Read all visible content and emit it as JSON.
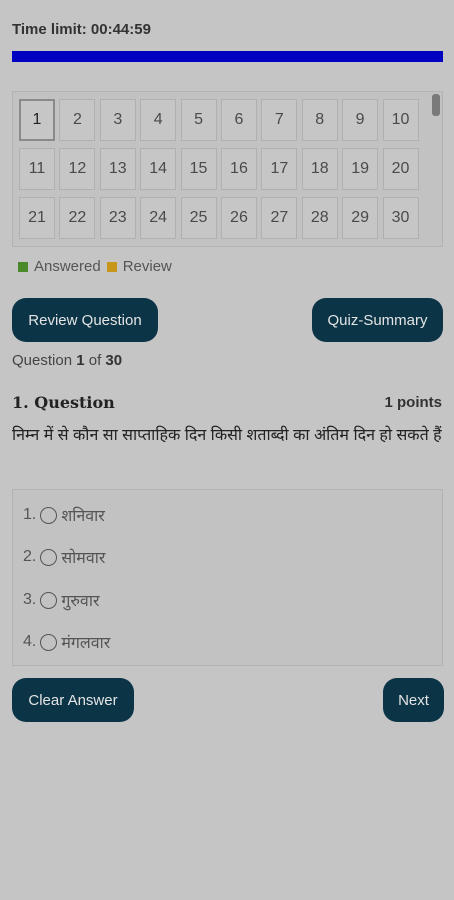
{
  "timer": {
    "label": "Time limit: 00:44:59"
  },
  "progress": {
    "fraction": 1.0,
    "color": "#0000c0"
  },
  "question_grid": {
    "numbers": [
      "1",
      "2",
      "3",
      "4",
      "5",
      "6",
      "7",
      "8",
      "9",
      "10",
      "11",
      "12",
      "13",
      "14",
      "15",
      "16",
      "17",
      "18",
      "19",
      "20",
      "21",
      "22",
      "23",
      "24",
      "25",
      "26",
      "27",
      "28",
      "29",
      "30"
    ],
    "current": 1
  },
  "legend": {
    "answered": "Answered",
    "review": "Review",
    "answered_color": "#4a8a2a",
    "review_color": "#c8961a"
  },
  "buttons": {
    "review_question": "Review Question",
    "quiz_summary": "Quiz-Summary",
    "clear_answer": "Clear Answer",
    "next": "Next"
  },
  "counter": {
    "prefix": "Question ",
    "current": "1",
    "mid": " of ",
    "total": "30"
  },
  "question": {
    "title": "1. Question",
    "points": "1 points",
    "text": "निम्न में से कौन सा साप्ताहिक दिन किसी शताब्दी का अंतिम दिन हो सकते हैं"
  },
  "options": [
    {
      "num": "1.",
      "label": "शनिवार"
    },
    {
      "num": "2.",
      "label": "सोमवार"
    },
    {
      "num": "3.",
      "label": "गुरुवार"
    },
    {
      "num": "4.",
      "label": "मंगलवार"
    }
  ]
}
